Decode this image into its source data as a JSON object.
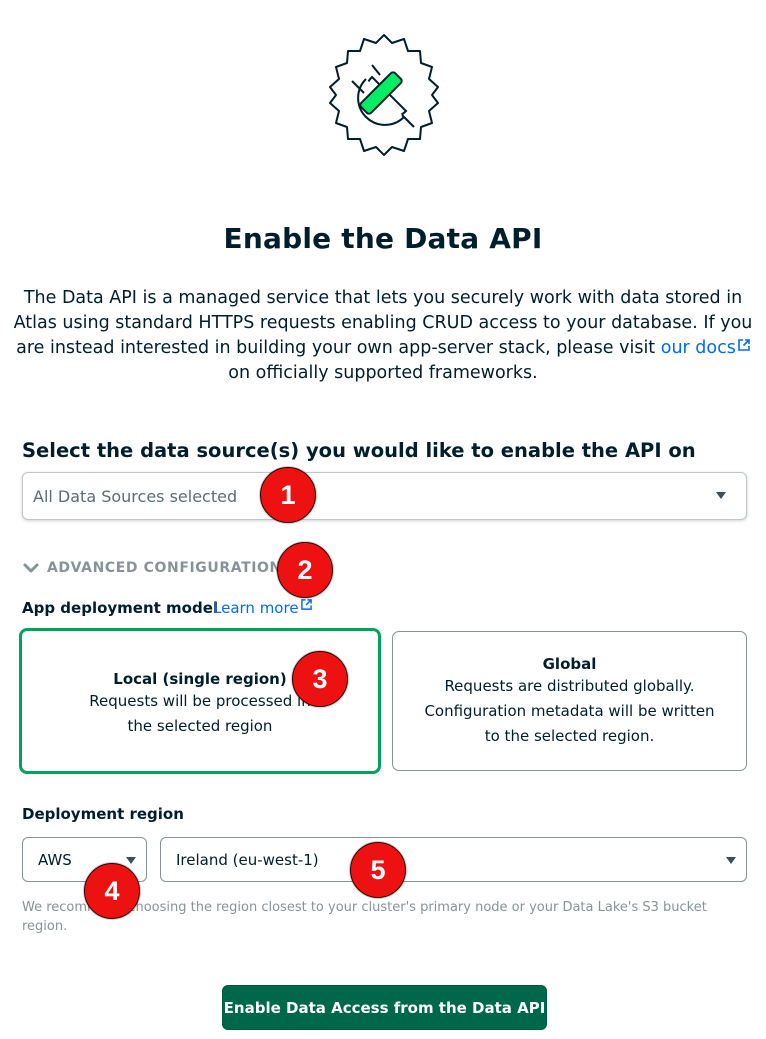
{
  "page": {
    "title": "Enable the Data API",
    "intro_text": "The Data API is a managed service that lets you securely work with data stored in Atlas using standard HTTPS requests enabling CRUD access to your database. If you are instead interested in building your own app-server stack, please visit",
    "intro_link": "our docs",
    "intro_tail": "on officially supported frameworks."
  },
  "data_source": {
    "label": "Select the data source(s) you would like to enable the API on",
    "selected": "All Data Sources selected"
  },
  "advanced": {
    "label": "ADVANCED CONFIGURATION"
  },
  "deployment_model": {
    "label": "App deployment model",
    "learn_more": "Learn more",
    "options": [
      {
        "title": "Local (single region)",
        "description": "Requests will be processed in the selected region",
        "selected": true
      },
      {
        "title": "Global",
        "description": "Requests are distributed globally. Configuration metadata will be written to the selected region.",
        "selected": false
      }
    ]
  },
  "deployment_region": {
    "label": "Deployment region",
    "provider": "AWS",
    "region": "Ireland (eu-west-1)",
    "hint": "We recommend choosing the region closest to your cluster's primary node or your Data Lake's S3 bucket region."
  },
  "actions": {
    "enable_label": "Enable Data Access from the Data API"
  },
  "markers": [
    "1",
    "2",
    "3",
    "4",
    "5"
  ],
  "colors": {
    "primary_green": "#00684a",
    "selected_border": "#00a35c",
    "link_blue": "#016bf8",
    "marker_red": "#ee1111"
  }
}
